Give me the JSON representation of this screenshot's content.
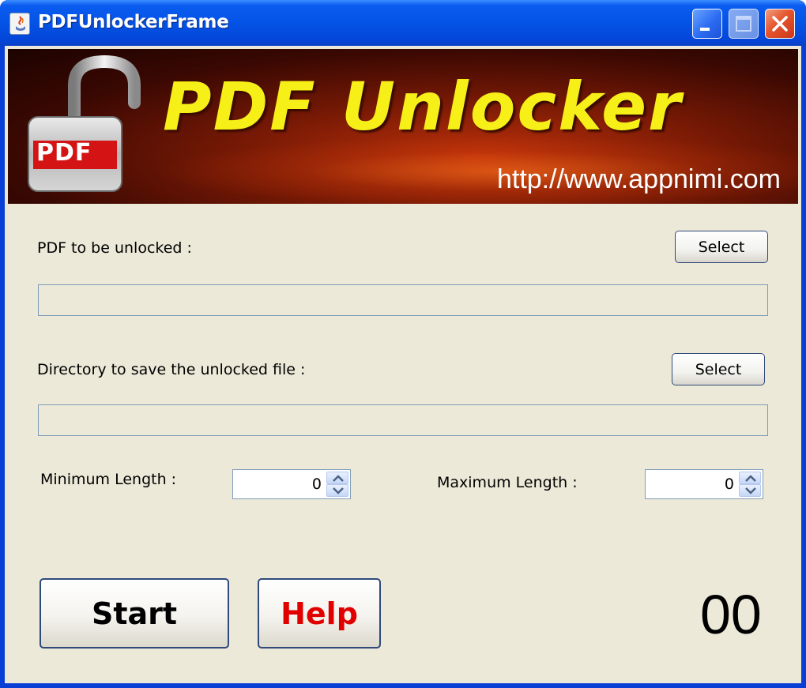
{
  "window": {
    "title": "PDFUnlockerFrame"
  },
  "banner": {
    "title": "PDF Unlocker",
    "url": "http://www.appnimi.com",
    "lock_badge_text": "PDF"
  },
  "form": {
    "pdf_label": "PDF to be unlocked :",
    "pdf_select_label": "Select",
    "pdf_path_value": "",
    "dir_label": "Directory to save the unlocked file :",
    "dir_select_label": "Select",
    "dir_path_value": "",
    "min_length_label": "Minimum Length :",
    "min_length_value": "0",
    "max_length_label": "Maximum Length :",
    "max_length_value": "0"
  },
  "actions": {
    "start_label": "Start",
    "help_label": "Help",
    "counter": "00"
  },
  "colors": {
    "title_bar": "#0453e6",
    "client_bg": "#ece9d8",
    "banner_text": "#f7f018",
    "help_text": "#e00000"
  },
  "icons": [
    "app-icon",
    "minimize-icon",
    "maximize-icon",
    "close-icon",
    "padlock-icon",
    "spinner-up-icon",
    "spinner-down-icon"
  ]
}
